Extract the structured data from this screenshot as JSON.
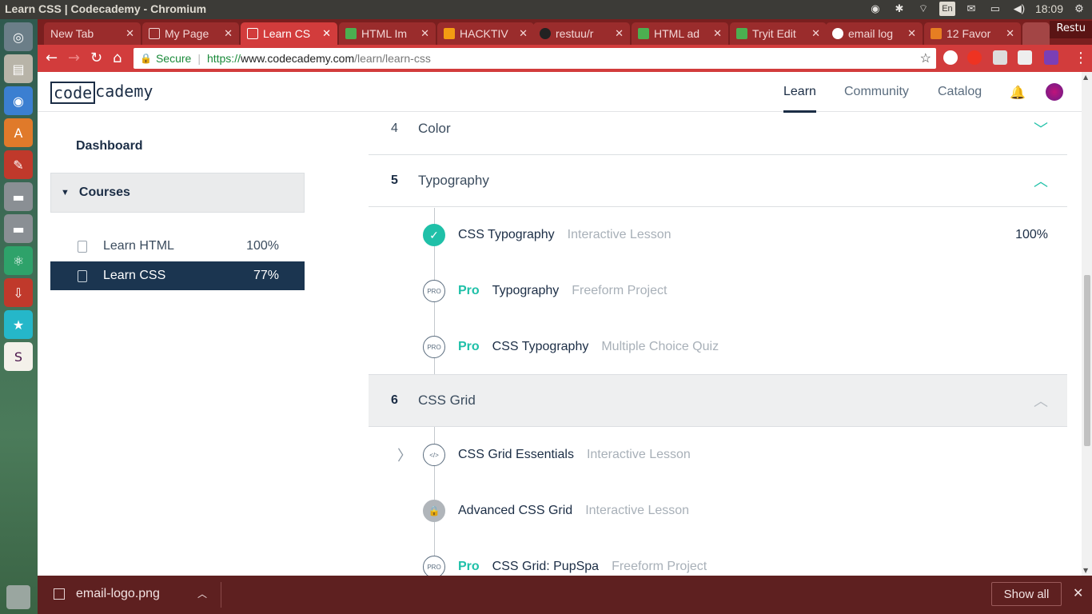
{
  "window": {
    "title": "Learn CSS | Codecademy - Chromium"
  },
  "tray": {
    "lang": "En",
    "time": "18:09"
  },
  "tabs": [
    {
      "label": "New Tab",
      "color": "#9a2c2c"
    },
    {
      "label": "My Page",
      "color": "#ffffff"
    },
    {
      "label": "Learn CS",
      "color": "#ffffff"
    },
    {
      "label": "HTML Im",
      "color": "#4caf50"
    },
    {
      "label": "HACKTIV",
      "color": "#f39c12"
    },
    {
      "label": "restuu/r",
      "color": "#222222"
    },
    {
      "label": "HTML ad",
      "color": "#4caf50"
    },
    {
      "label": "Tryit Edit",
      "color": "#4caf50"
    },
    {
      "label": "email log",
      "color": "#4285f4"
    },
    {
      "label": "12 Favor",
      "color": "#e67e22"
    }
  ],
  "profile_label": "Restu",
  "omnibox": {
    "secure": "Secure",
    "scheme": "https://",
    "host": "www.codecademy.com",
    "path": "/learn/learn-css"
  },
  "site": {
    "logo_a": "code",
    "logo_b": "cademy",
    "nav": [
      "Learn",
      "Community",
      "Catalog"
    ]
  },
  "sidebar": {
    "dashboard": "Dashboard",
    "courses_header": "Courses",
    "courses": [
      {
        "name": "Learn HTML",
        "progress": "100%"
      },
      {
        "name": "Learn CSS",
        "progress": "77%"
      }
    ]
  },
  "syllabus": {
    "section4": {
      "num": "4",
      "name": "Color"
    },
    "section5": {
      "num": "5",
      "name": "Typography"
    },
    "section5_items": [
      {
        "pro": "",
        "title": "CSS Typography",
        "kind": "Interactive Lesson",
        "progress": "100%"
      },
      {
        "pro": "Pro",
        "title": "Typography",
        "kind": "Freeform Project",
        "marker": "PRO"
      },
      {
        "pro": "Pro",
        "title": "CSS Typography",
        "kind": "Multiple Choice Quiz",
        "marker": "PRO"
      }
    ],
    "section6": {
      "num": "6",
      "name": "CSS Grid"
    },
    "section6_items": [
      {
        "pro": "",
        "title": "CSS Grid Essentials",
        "kind": "Interactive Lesson",
        "marker": "</>"
      },
      {
        "pro": "",
        "title": "Advanced CSS Grid",
        "kind": "Interactive Lesson"
      },
      {
        "pro": "Pro",
        "title": "CSS Grid: PupSpa",
        "kind": "Freeform Project",
        "marker": "PRO"
      }
    ]
  },
  "download_bar": {
    "filename": "email-logo.png",
    "show_all": "Show all"
  },
  "colors": {
    "accent": "#1fc0a8",
    "navy": "#1b2d45",
    "chrome_red": "#d23c3c"
  }
}
